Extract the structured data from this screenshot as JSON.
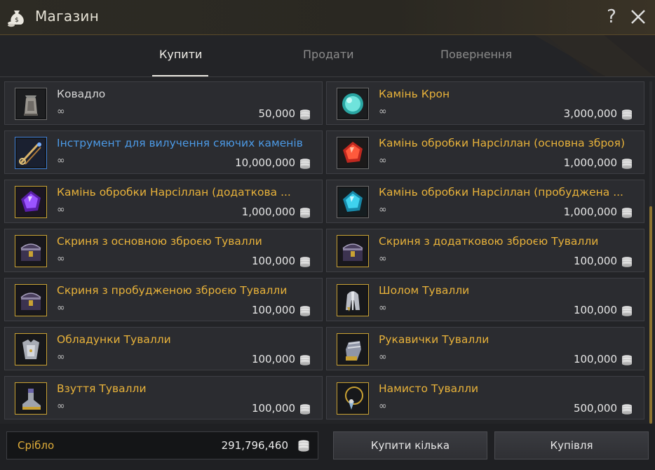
{
  "window": {
    "title": "Магазин",
    "help_label": "?",
    "close_icon": "close-icon"
  },
  "tabs": [
    {
      "label": "Купити",
      "active": true
    },
    {
      "label": "Продати",
      "active": false
    },
    {
      "label": "Повернення",
      "active": false
    }
  ],
  "items": [
    {
      "name": "Ковадло",
      "qty": "∞",
      "price": "50,000",
      "name_color": "white",
      "frame": "grey",
      "icon": "anvil-icon"
    },
    {
      "name": "Камінь Крон",
      "qty": "∞",
      "price": "3,000,000",
      "name_color": "gold",
      "frame": "grey",
      "icon": "cron-stone-icon"
    },
    {
      "name": "Інструмент для вилучення сяючих каменів",
      "qty": "∞",
      "price": "10,000,000",
      "name_color": "blue",
      "frame": "blue",
      "icon": "extraction-tool-icon"
    },
    {
      "name": "Камінь обробки Нарсіллан (основна зброя)",
      "qty": "∞",
      "price": "1,000,000",
      "name_color": "gold",
      "frame": "grey",
      "icon": "red-gem-icon"
    },
    {
      "name": "Камінь обробки Нарсіллан (додаткова ...",
      "qty": "∞",
      "price": "1,000,000",
      "name_color": "gold",
      "frame": "gold",
      "icon": "purple-gem-icon"
    },
    {
      "name": "Камінь обробки Нарсіллан (пробуджена ...",
      "qty": "∞",
      "price": "1,000,000",
      "name_color": "gold",
      "frame": "grey",
      "icon": "cyan-gem-icon"
    },
    {
      "name": "Скриня з основною зброєю Тувалли",
      "qty": "∞",
      "price": "100,000",
      "name_color": "gold",
      "frame": "gold",
      "icon": "chest-icon"
    },
    {
      "name": "Скриня з додатковою зброєю Тувалли",
      "qty": "∞",
      "price": "100,000",
      "name_color": "gold",
      "frame": "gold",
      "icon": "chest-icon"
    },
    {
      "name": "Скриня з пробудженою зброєю Тувалли",
      "qty": "∞",
      "price": "100,000",
      "name_color": "gold",
      "frame": "gold",
      "icon": "chest-icon"
    },
    {
      "name": "Шолом Тувалли",
      "qty": "∞",
      "price": "100,000",
      "name_color": "gold",
      "frame": "gold",
      "icon": "helmet-icon"
    },
    {
      "name": "Обладунки Тувалли",
      "qty": "∞",
      "price": "100,000",
      "name_color": "gold",
      "frame": "gold",
      "icon": "armor-icon"
    },
    {
      "name": "Рукавички Тувалли",
      "qty": "∞",
      "price": "100,000",
      "name_color": "gold",
      "frame": "gold",
      "icon": "gloves-icon"
    },
    {
      "name": "Взуття Тувалли",
      "qty": "∞",
      "price": "100,000",
      "name_color": "gold",
      "frame": "gold",
      "icon": "shoes-icon"
    },
    {
      "name": "Намисто Тувалли",
      "qty": "∞",
      "price": "500,000",
      "name_color": "gold",
      "frame": "gold",
      "icon": "necklace-icon"
    }
  ],
  "footer": {
    "silver_label": "Срібло",
    "silver_value": "291,796,460",
    "buy_multiple_label": "Купити кілька",
    "purchase_label": "Купівля"
  },
  "colors": {
    "gold_text": "#e8b23a",
    "blue_text": "#4c9ae6",
    "frame_gold": "#c9a133"
  }
}
